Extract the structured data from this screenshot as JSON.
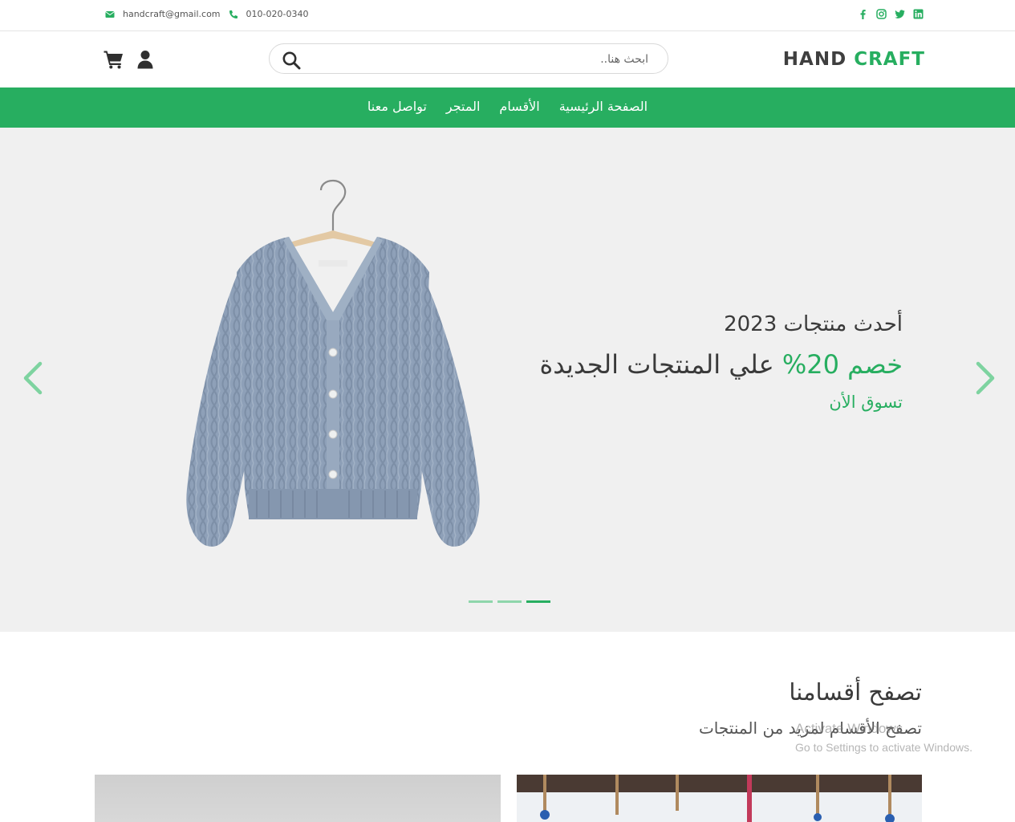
{
  "topbar": {
    "email": "handcraft@gmail.com",
    "phone": "010-020-0340",
    "social": [
      "facebook-icon",
      "instagram-icon",
      "twitter-icon",
      "linkedin-icon"
    ]
  },
  "header": {
    "logo_part1": "HAND",
    "logo_part2": "CRAFT",
    "search_placeholder": "ابحث هنا..",
    "icons": [
      "cart-icon",
      "user-icon",
      "search-icon"
    ]
  },
  "nav": {
    "items": [
      "الصفحة الرئيسية",
      "الأقسام",
      "المتجر",
      "تواصل معنا"
    ]
  },
  "hero": {
    "subtitle": "أحدث منتجات 2023",
    "title_discount": "خصم 20%",
    "title_rest": " علي المنتجات الجديدة",
    "cta": "تسوق الأن",
    "slides": 3,
    "active_slide": 3
  },
  "categories": {
    "title": "تصفح أقسامنا",
    "subtitle": "تصفح الأقسام لمزيد من المنتجات"
  },
  "watermark": {
    "line1": "Activate Windows",
    "line2": "Go to Settings to activate Windows."
  },
  "colors": {
    "accent": "#27ae60",
    "hero_bg": "#f0f0f0",
    "text": "#3a3a3a"
  }
}
